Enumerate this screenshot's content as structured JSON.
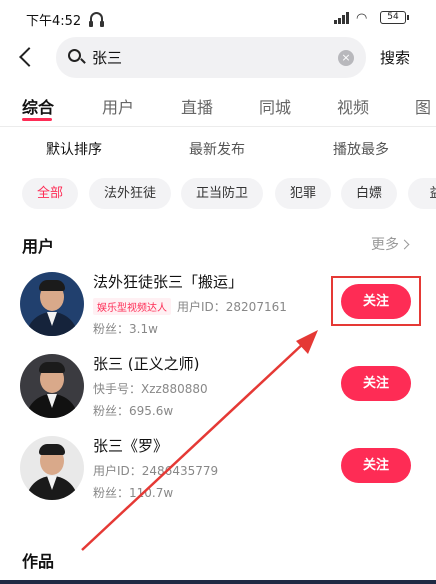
{
  "status_bar": {
    "time": "下午4:52",
    "battery": "54"
  },
  "search": {
    "query": "张三",
    "clear": "×",
    "submit": "搜索"
  },
  "tabs": [
    {
      "label": "综合",
      "active": true
    },
    {
      "label": "用户"
    },
    {
      "label": "直播"
    },
    {
      "label": "同城"
    },
    {
      "label": "视频"
    },
    {
      "label": "图"
    }
  ],
  "sort_options": [
    {
      "label": "默认排序",
      "active": true
    },
    {
      "label": "最新发布"
    },
    {
      "label": "播放最多"
    }
  ],
  "filters": [
    {
      "label": "全部",
      "active": true
    },
    {
      "label": "法外狂徒"
    },
    {
      "label": "正当防卫"
    },
    {
      "label": "犯罪"
    },
    {
      "label": "白嫖"
    },
    {
      "label": "益"
    }
  ],
  "users_section": {
    "title": "用户",
    "more": "更多"
  },
  "users": [
    {
      "name": "法外狂徒张三「搬运」",
      "badge": "娱乐型视频达人",
      "id_text": "用户ID：28207161",
      "fans": "粉丝：3.1w",
      "follow": "关注"
    },
    {
      "name": "张三 (正义之师)",
      "id_text": "快手号：Xzz880880",
      "fans": "粉丝：695.6w",
      "follow": "关注"
    },
    {
      "name": "张三《罗》",
      "id_text": "用户ID：2486435779",
      "fans": "粉丝：110.7w",
      "follow": "关注"
    }
  ],
  "works_section": {
    "title": "作品"
  },
  "colors": {
    "accent": "#fe2c55",
    "annotation": "#e53935"
  }
}
